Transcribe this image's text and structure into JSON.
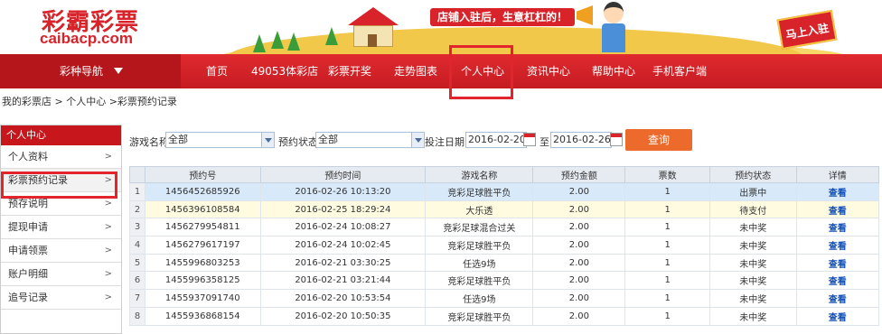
{
  "logo": {
    "cn": "彩霸彩票",
    "en": "caibacp.com"
  },
  "banner": {
    "slogan": "店铺入驻后，生意杠杠的！",
    "sign": "马上入驻"
  },
  "nav": {
    "guide": "彩种导航",
    "items": [
      "首页",
      "49053体彩店",
      "彩票开奖",
      "走势图表",
      "个人中心",
      "资讯中心",
      "帮助中心",
      "手机客户端"
    ],
    "active": "个人中心"
  },
  "breadcrumb": "我的彩票店 > 个人中心 >彩票预约记录",
  "sidebar": {
    "title": "个人中心",
    "items": [
      {
        "label": "个人资料"
      },
      {
        "label": "彩票预约记录"
      },
      {
        "label": "预存说明"
      },
      {
        "label": "提现申请"
      },
      {
        "label": "申请领票"
      },
      {
        "label": "账户明细"
      },
      {
        "label": "追号记录"
      }
    ],
    "active": "彩票预约记录"
  },
  "filter": {
    "game_label": "游戏名称",
    "game_value": "全部",
    "status_label": "预约状态",
    "status_value": "全部",
    "date_label": "投注日期",
    "date_from": "2016-02-20",
    "to_label": "至",
    "date_to": "2016-02-26",
    "query_label": "查询"
  },
  "table": {
    "headers": [
      "预约号",
      "预约时间",
      "游戏名称",
      "预约金额",
      "票数",
      "预约状态",
      "详情"
    ],
    "rows": [
      [
        "1",
        "1456452685926",
        "2016-02-26 10:13:20",
        "竞彩足球胜平负",
        "2.00",
        "1",
        "出票中",
        "查看"
      ],
      [
        "2",
        "1456396108584",
        "2016-02-25 18:29:24",
        "大乐透",
        "2.00",
        "1",
        "待支付",
        "查看"
      ],
      [
        "3",
        "1456279954811",
        "2016-02-24 10:08:27",
        "竞彩足球混合过关",
        "2.00",
        "1",
        "未中奖",
        "查看"
      ],
      [
        "4",
        "1456279617197",
        "2016-02-24 10:02:45",
        "竞彩足球胜平负",
        "2.00",
        "1",
        "未中奖",
        "查看"
      ],
      [
        "5",
        "1455996803253",
        "2016-02-21 03:30:25",
        "任选9场",
        "2.00",
        "1",
        "未中奖",
        "查看"
      ],
      [
        "6",
        "1455996358125",
        "2016-02-21 03:21:44",
        "竞彩足球胜平负",
        "2.00",
        "1",
        "未中奖",
        "查看"
      ],
      [
        "7",
        "1455937091740",
        "2016-02-20 10:53:54",
        "任选9场",
        "2.00",
        "1",
        "未中奖",
        "查看"
      ],
      [
        "8",
        "1455936868154",
        "2016-02-20 10:50:35",
        "竞彩足球胜平负",
        "2.00",
        "1",
        "未中奖",
        "查看"
      ]
    ]
  },
  "colors": {
    "brand_red": "#d8232a",
    "query_orange": "#ec6a2c",
    "link_blue": "#1150b8"
  }
}
